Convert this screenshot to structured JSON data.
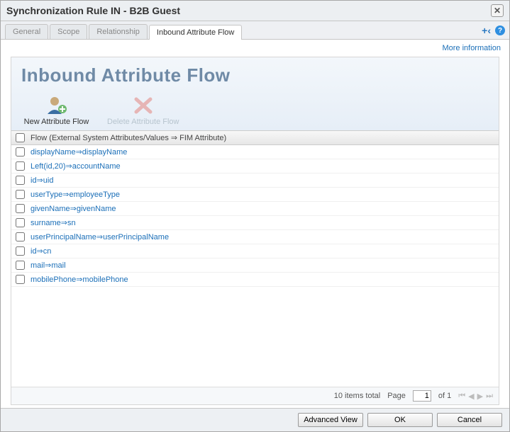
{
  "window": {
    "title": "Synchronization Rule IN - B2B Guest"
  },
  "tabs": [
    {
      "label": "General"
    },
    {
      "label": "Scope"
    },
    {
      "label": "Relationship"
    },
    {
      "label": "Inbound Attribute Flow"
    }
  ],
  "active_tab_index": 3,
  "more_info": "More information",
  "panel": {
    "title": "Inbound Attribute Flow",
    "actions": {
      "new_label": "New Attribute Flow",
      "delete_label": "Delete Attribute Flow"
    }
  },
  "grid": {
    "column_header": "Flow (External System Attributes/Values ⇒ FIM Attribute)",
    "rows": [
      {
        "text": "displayName⇒displayName"
      },
      {
        "text": "Left(id,20)⇒accountName"
      },
      {
        "text": "id⇒uid"
      },
      {
        "text": "userType⇒employeeType"
      },
      {
        "text": "givenName⇒givenName"
      },
      {
        "text": "surname⇒sn"
      },
      {
        "text": "userPrincipalName⇒userPrincipalName"
      },
      {
        "text": "id⇒cn"
      },
      {
        "text": "mail⇒mail"
      },
      {
        "text": "mobilePhone⇒mobilePhone"
      }
    ],
    "footer": {
      "total_text": "10 items total",
      "page_label": "Page",
      "page_value": "1",
      "page_of": "of 1"
    }
  },
  "footer": {
    "advanced": "Advanced View",
    "ok": "OK",
    "cancel": "Cancel"
  }
}
